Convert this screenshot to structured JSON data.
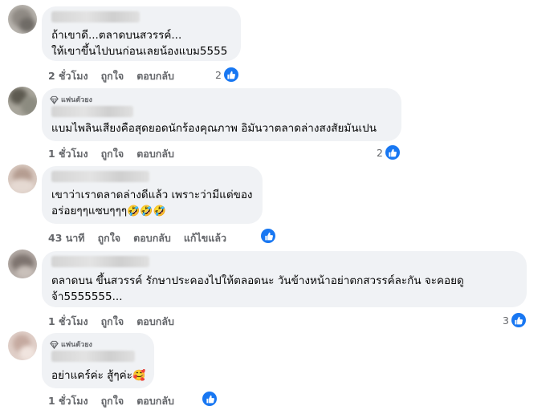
{
  "colors": {
    "bubble": "#f0f2f5",
    "meta_text": "#65676b",
    "like_blue": "#1877f2"
  },
  "comments": [
    {
      "badge": "",
      "lines": [
        "ถ้าเขาดี...ตลาดบนสวรรค์...",
        "ให้เขาขึ้นไปบนก่อนเลยน้องแบม5555"
      ],
      "time": "2 ชั่วโมง",
      "like_label": "ถูกใจ",
      "reply_label": "ตอบกลับ",
      "edited": "",
      "reaction_count": "2"
    },
    {
      "badge": "แฟนตัวยง",
      "lines": [
        "แบมไพลินเสียงคือสุดยอดนักร้องคุณภาพ อิมันวาตลาดล่างสงสัยมันเปน"
      ],
      "time": "1 ชั่วโมง",
      "like_label": "ถูกใจ",
      "reply_label": "ตอบกลับ",
      "edited": "",
      "reaction_count": "2"
    },
    {
      "badge": "",
      "lines": [
        "เขาว่าเราตลาดล่างดีแล้ว เพราะว่ามีแต่ของ",
        "อร่อยๆๆแซบๆๆๆ"
      ],
      "emoji": "🤣🤣🤣",
      "time": "43 นาที",
      "like_label": "ถูกใจ",
      "reply_label": "ตอบกลับ",
      "edited": "แก้ไขแล้ว",
      "reaction_count": ""
    },
    {
      "badge": "",
      "lines": [
        "ตลาดบน ขึ้นสวรรค์ รักษาประคองไปให้ตลอดนะ วันข้างหน้าอย่าตกสวรรค์ละกัน จะคอยดู",
        "จ้า5555555..."
      ],
      "time": "1 ชั่วโมง",
      "like_label": "ถูกใจ",
      "reply_label": "ตอบกลับ",
      "edited": "",
      "reaction_count": "3"
    },
    {
      "badge": "แฟนตัวยง",
      "lines": [
        "อย่าแคร์ค่ะ สู้ๆค่ะ"
      ],
      "emoji": "🥰",
      "time": "1 ชั่วโมง",
      "like_label": "ถูกใจ",
      "reply_label": "ตอบกลับ",
      "edited": "",
      "reaction_count": ""
    }
  ]
}
